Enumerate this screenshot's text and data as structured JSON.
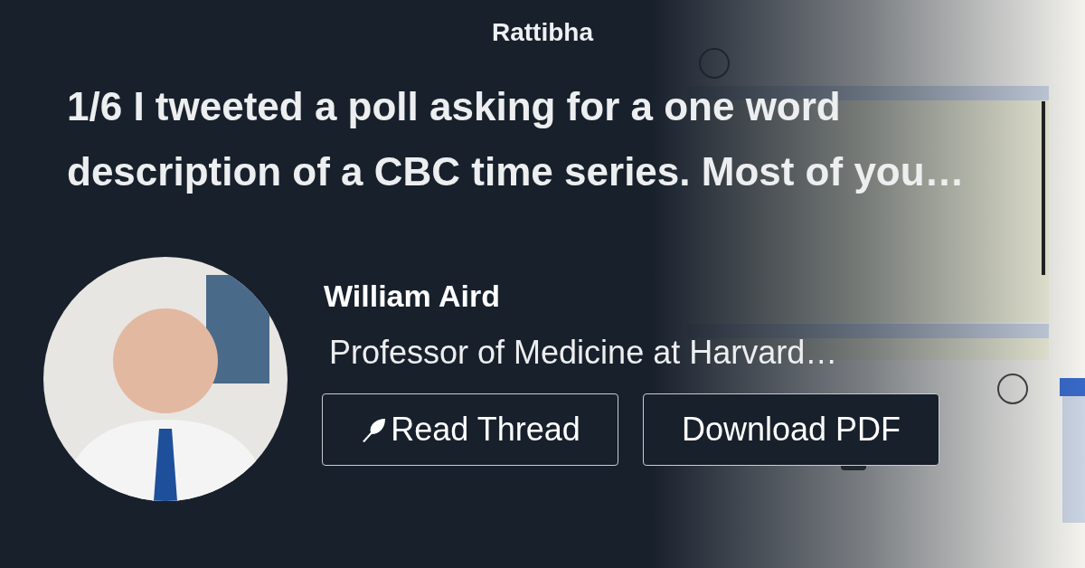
{
  "site": {
    "title": "Rattibha"
  },
  "tweet": {
    "text": "1/6 I tweeted a poll asking for a one word description of a CBC time series. Most of you…"
  },
  "author": {
    "name": "William Aird",
    "bio": "Professor of Medicine at Harvard…"
  },
  "buttons": [
    {
      "label": "Read Thread",
      "kind": "read"
    },
    {
      "label": "Download PDF",
      "kind": "download"
    }
  ]
}
